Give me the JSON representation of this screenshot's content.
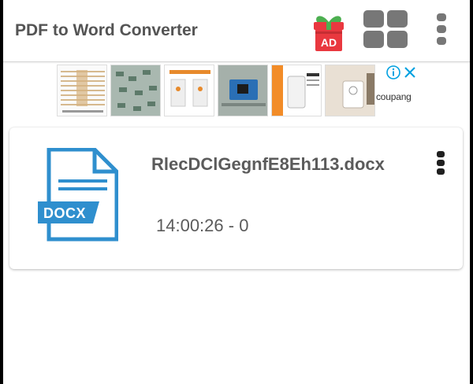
{
  "app": {
    "title": "PDF to Word Converter"
  },
  "toolbar": {
    "ad_badge_label": "AD",
    "ad_icon": "gift-icon",
    "grid_icon": "grid-view-icon",
    "menu_icon": "more-vert-icon"
  },
  "ad_banner": {
    "brand": "coupang",
    "info_icon": "info-icon",
    "close_icon": "close-icon",
    "thumbnail_count": 6
  },
  "files": [
    {
      "name": "RlecDClGegnfE8Eh113.docx",
      "time": "14:00:26 - 0",
      "type_label": "DOCX",
      "icon": "docx-file-icon",
      "menu_icon": "more-vert-icon"
    }
  ],
  "colors": {
    "accent_blue": "#2f8fce",
    "ad_red": "#e9383f",
    "gift_green": "#4caf50",
    "grid_gray": "#777777",
    "text_dark": "#545454",
    "coupang_blue": "#00a0e0"
  }
}
